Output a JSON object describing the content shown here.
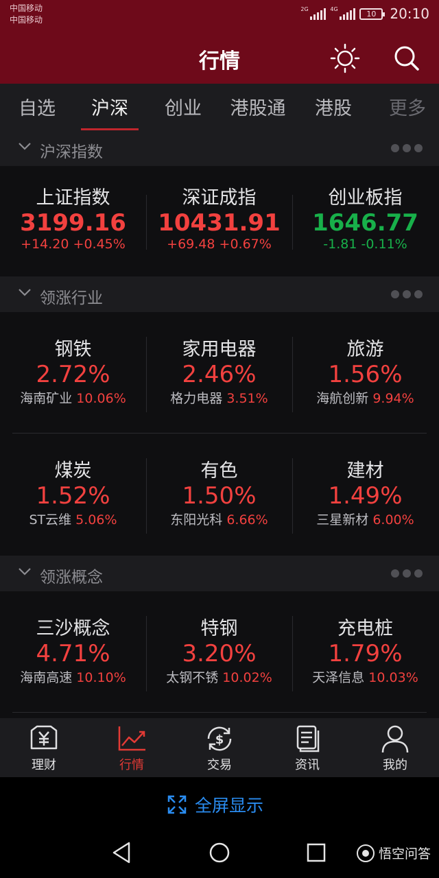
{
  "status_bar": {
    "carrier_1": "中国移动",
    "carrier_2": "中国移动",
    "sim1_network": "2G",
    "sim2_network": "4G",
    "battery": "10",
    "time": "20:10"
  },
  "header": {
    "title": "行情"
  },
  "tabs": [
    {
      "label": "自选"
    },
    {
      "label": "沪深",
      "active": true
    },
    {
      "label": "创业"
    },
    {
      "label": "港股通"
    },
    {
      "label": "港股"
    },
    {
      "label": "更多"
    }
  ],
  "sections": {
    "indices": {
      "title": "沪深指数"
    },
    "industries": {
      "title": "领涨行业"
    },
    "concepts": {
      "title": "领涨概念"
    }
  },
  "indices": [
    {
      "name": "上证指数",
      "value": "3199.16",
      "change": "+14.20 +0.45%",
      "direction": "up"
    },
    {
      "name": "深证成指",
      "value": "10431.91",
      "change": "+69.48 +0.67%",
      "direction": "up"
    },
    {
      "name": "创业板指",
      "value": "1646.77",
      "change": "-1.81 -0.11%",
      "direction": "down"
    }
  ],
  "industries": [
    {
      "name": "钢铁",
      "pct": "2.72%",
      "stock": "海南矿业",
      "stock_pct": "10.06%"
    },
    {
      "name": "家用电器",
      "pct": "2.46%",
      "stock": "格力电器",
      "stock_pct": "3.51%"
    },
    {
      "name": "旅游",
      "pct": "1.56%",
      "stock": "海航创新",
      "stock_pct": "9.94%"
    },
    {
      "name": "煤炭",
      "pct": "1.52%",
      "stock": "ST云维",
      "stock_pct": "5.06%"
    },
    {
      "name": "有色",
      "pct": "1.50%",
      "stock": "东阳光科",
      "stock_pct": "6.66%"
    },
    {
      "name": "建材",
      "pct": "1.49%",
      "stock": "三星新材",
      "stock_pct": "6.00%"
    }
  ],
  "concepts": [
    {
      "name": "三沙概念",
      "pct": "4.71%",
      "stock": "海南高速",
      "stock_pct": "10.10%"
    },
    {
      "name": "特钢",
      "pct": "3.20%",
      "stock": "太钢不锈",
      "stock_pct": "10.02%"
    },
    {
      "name": "充电桩",
      "pct": "1.79%",
      "stock": "天泽信息",
      "stock_pct": "10.03%"
    }
  ],
  "bottom_nav": [
    {
      "label": "理财"
    },
    {
      "label": "行情",
      "active": true
    },
    {
      "label": "交易"
    },
    {
      "label": "资讯"
    },
    {
      "label": "我的"
    }
  ],
  "fullscreen": {
    "label": "全屏显示"
  },
  "watermark": {
    "text": "悟空问答"
  },
  "colors": {
    "header_bg": "#6e0a1a",
    "up": "#f2413f",
    "down": "#18b04a",
    "accent_blue": "#2a8cf0"
  }
}
